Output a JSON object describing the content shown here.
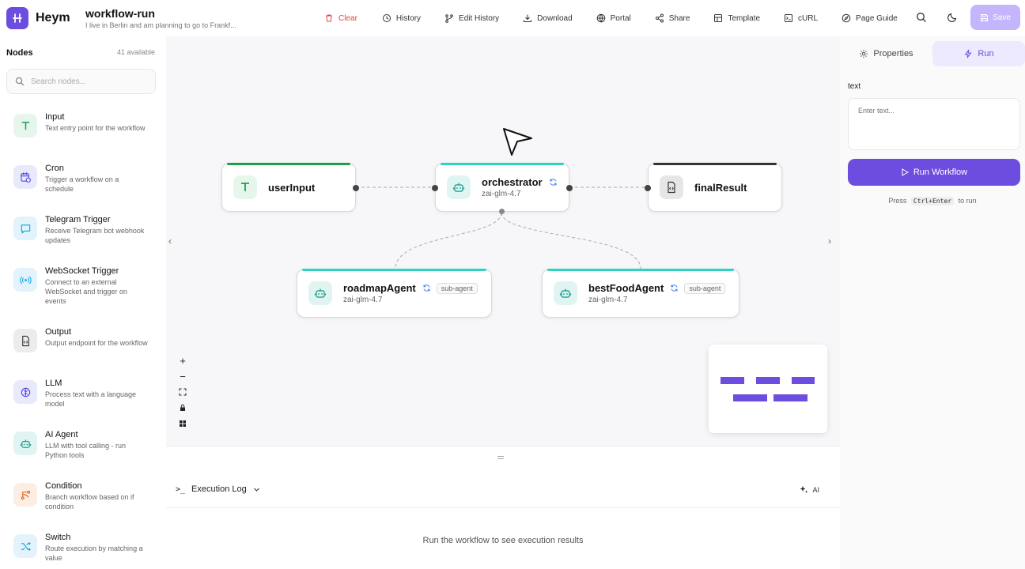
{
  "app": {
    "brand": "Heym",
    "workflow_name": "workflow-run",
    "workflow_description": "I live in Berlin and am planning to go to Frankf..."
  },
  "toolbar": {
    "clear": "Clear",
    "history": "History",
    "edit_history": "Edit History",
    "download": "Download",
    "portal": "Portal",
    "share": "Share",
    "template": "Template",
    "curl": "cURL",
    "page_guide": "Page Guide",
    "save": "Save"
  },
  "sidebar": {
    "title": "Nodes",
    "count": "41 available",
    "search_placeholder": "Search nodes...",
    "items": [
      {
        "name": "Input",
        "desc": "Text entry point for the workflow",
        "icon": "text-icon",
        "color": "#16a34a",
        "bg": "#e7f6ec"
      },
      {
        "name": "Cron",
        "desc": "Trigger a workflow on a schedule",
        "icon": "calendar-clock-icon",
        "color": "#4f46e5",
        "bg": "#e8eafc"
      },
      {
        "name": "Telegram Trigger",
        "desc": "Receive Telegram bot webhook updates",
        "icon": "chat-icon",
        "color": "#0ea5e9",
        "bg": "#e2f3fb"
      },
      {
        "name": "WebSocket Trigger",
        "desc": "Connect to an external WebSocket and trigger on events",
        "icon": "broadcast-icon",
        "color": "#0ea5e9",
        "bg": "#e2f3fb"
      },
      {
        "name": "Output",
        "desc": "Output endpoint for the workflow",
        "icon": "file-code-icon",
        "color": "#333333",
        "bg": "#ececec"
      },
      {
        "name": "LLM",
        "desc": "Process text with a language model",
        "icon": "brain-icon",
        "color": "#4f46e5",
        "bg": "#e8eafc"
      },
      {
        "name": "AI Agent",
        "desc": "LLM with tool calling - run Python tools",
        "icon": "robot-icon",
        "color": "#0d9488",
        "bg": "#e0f5f2"
      },
      {
        "name": "Condition",
        "desc": "Branch workflow based on if condition",
        "icon": "branch-icon",
        "color": "#ea580c",
        "bg": "#fdeee4"
      },
      {
        "name": "Switch",
        "desc": "Route execution by matching a value",
        "icon": "shuffle-icon",
        "color": "#0ea5e9",
        "bg": "#e2f3fb"
      }
    ]
  },
  "canvas": {
    "nodes": {
      "userInput": {
        "title": "userInput"
      },
      "orchestrator": {
        "title": "orchestrator",
        "model": "zai-glm-4.7"
      },
      "finalResult": {
        "title": "finalResult"
      },
      "roadmapAgent": {
        "title": "roadmapAgent",
        "model": "zai-glm-4.7",
        "badge": "sub-agent"
      },
      "bestFoodAgent": {
        "title": "bestFoodAgent",
        "model": "zai-glm-4.7",
        "badge": "sub-agent"
      }
    },
    "zoom_controls": {
      "zoom_in": "+",
      "zoom_out": "−"
    }
  },
  "log": {
    "title": "Execution Log",
    "prompt": ">_",
    "ai": "AI",
    "empty": "Run the workflow to see execution results"
  },
  "panel": {
    "tab_properties": "Properties",
    "tab_run": "Run",
    "field_label": "text",
    "placeholder": "Enter text...",
    "run_button": "Run Workflow",
    "hint_press": "Press",
    "hint_keys": "Ctrl+Enter",
    "hint_suffix": "to run"
  },
  "colors": {
    "accent": "#6d4de0",
    "teal": "#2dd4bf",
    "green": "#16a34a",
    "danger": "#e0453d"
  }
}
